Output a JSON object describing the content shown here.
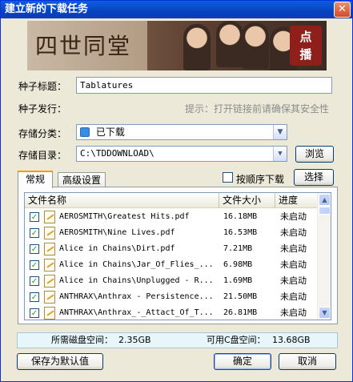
{
  "window": {
    "title": "建立新的下载任务",
    "close_glyph": "✕"
  },
  "banner": {
    "title_text": "四世同堂",
    "seal_text": "点\n播"
  },
  "form": {
    "torrent_title_label": "种子标题：",
    "torrent_title_value": "Tablatures",
    "torrent_publisher_label": "种子发行：",
    "hint": "提示：打开链接前请确保其安全性",
    "category_label": "存储分类：",
    "category_value": "已下载",
    "dir_label": "存储目录：",
    "dir_value": "C:\\TDDOWNLOAD\\",
    "browse_button": "浏览"
  },
  "tabs": [
    {
      "label": "常规",
      "active": true
    },
    {
      "label": "高级设置",
      "active": false
    }
  ],
  "sequential_label": "按顺序下载",
  "select_button": "选择",
  "file_list": {
    "columns": [
      "文件名称",
      "文件大小",
      "进度"
    ],
    "rows": [
      {
        "name": "AEROSMITH\\Greatest Hits.pdf",
        "size": "16.18MB",
        "status": "未启动"
      },
      {
        "name": "AEROSMITH\\Nine Lives.pdf",
        "size": "16.53MB",
        "status": "未启动"
      },
      {
        "name": "Alice in Chains\\Dirt.pdf",
        "size": "7.21MB",
        "status": "未启动"
      },
      {
        "name": "Alice in Chains\\Jar_Of_Flies_...",
        "size": "6.98MB",
        "status": "未启动"
      },
      {
        "name": "Alice in Chains\\Unplugged - R...",
        "size": "1.69MB",
        "status": "未启动"
      },
      {
        "name": "ANTHRAX\\Anthrax - Persistence...",
        "size": "21.50MB",
        "status": "未启动"
      },
      {
        "name": "ANTHRAX\\Anthrax_-_Attact_Of_T...",
        "size": "26.81MB",
        "status": "未启动"
      }
    ]
  },
  "disk": {
    "required_label": "所需磁盘空间：",
    "required_value": "2.35GB",
    "available_label": "可用C盘空间：",
    "available_value": "13.68GB"
  },
  "buttons": {
    "save_default": "保存为默认值",
    "ok": "确定",
    "cancel": "取消"
  },
  "colors": {
    "titlebar": "#0842C2",
    "check": "#21A121",
    "hint": "#8C8C8C"
  }
}
